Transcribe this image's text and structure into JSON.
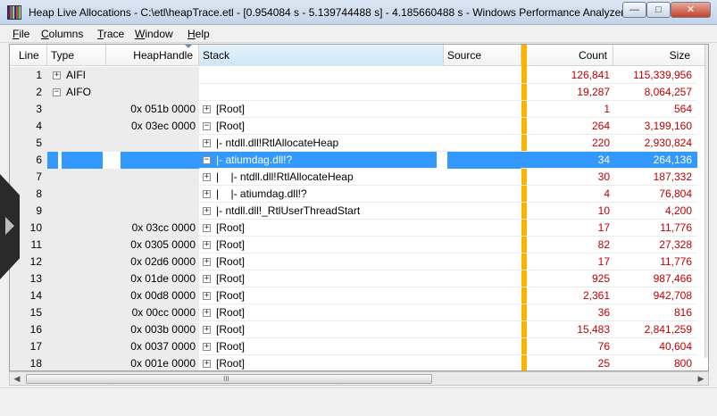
{
  "window": {
    "title": "Heap Live Allocations - C:\\etl\\heapTrace.etl - [0.954084 s - 5.139744488 s] - 4.185660488 s - Windows Performance Analyzer",
    "min_glyph": "—",
    "max_glyph": "□",
    "close_glyph": "✕"
  },
  "menu": [
    {
      "acc": "F",
      "rest": "ile"
    },
    {
      "acc": "C",
      "rest": "olumns"
    },
    {
      "acc": "T",
      "rest": "race"
    },
    {
      "acc": "W",
      "rest": "indow"
    },
    {
      "acc": "H",
      "rest": "elp"
    }
  ],
  "columns": {
    "line": "Line",
    "type": "Type",
    "heaphandle": "HeapHandle",
    "stack": "Stack",
    "source": "Source",
    "count": "Count",
    "size": "Size"
  },
  "rows": [
    {
      "line": "1",
      "type_exp": "+",
      "type": "AIFI",
      "hh": "",
      "stack_exp": "",
      "stack": "",
      "count": "126,841",
      "size": "115,339,956"
    },
    {
      "line": "2",
      "type_exp": "−",
      "type": "AIFO",
      "hh": "",
      "stack_exp": "",
      "stack": "",
      "count": "19,287",
      "size": "8,064,257"
    },
    {
      "line": "3",
      "type_exp": "",
      "type": "",
      "hh": "0x 051b 0000",
      "stack_exp": "+",
      "stack": "[Root]",
      "count": "1",
      "size": "564"
    },
    {
      "line": "4",
      "type_exp": "",
      "type": "",
      "hh": "0x 03ec 0000",
      "stack_exp": "−",
      "stack": "[Root]",
      "count": "264",
      "size": "3,199,160"
    },
    {
      "line": "5",
      "type_exp": "",
      "type": "",
      "hh": "",
      "stack_exp": "+",
      "stack": "|- ntdll.dll!RtlAllocateHeap",
      "count": "220",
      "size": "2,930,824"
    },
    {
      "line": "6",
      "type_exp": "",
      "type": "",
      "hh": "",
      "stack_exp": "−",
      "stack": "|- atiumdag.dll!?",
      "count": "34",
      "size": "264,136"
    },
    {
      "line": "7",
      "type_exp": "",
      "type": "",
      "hh": "",
      "stack_exp": "+",
      "stack": "|    |- ntdll.dll!RtlAllocateHeap",
      "count": "30",
      "size": "187,332"
    },
    {
      "line": "8",
      "type_exp": "",
      "type": "",
      "hh": "",
      "stack_exp": "+",
      "stack": "|    |- atiumdag.dll!?",
      "count": "4",
      "size": "76,804"
    },
    {
      "line": "9",
      "type_exp": "",
      "type": "",
      "hh": "",
      "stack_exp": "+",
      "stack": "|- ntdll.dll!_RtlUserThreadStart",
      "count": "10",
      "size": "4,200"
    },
    {
      "line": "10",
      "type_exp": "",
      "type": "",
      "hh": "0x 03cc 0000",
      "stack_exp": "+",
      "stack": "[Root]",
      "count": "17",
      "size": "11,776"
    },
    {
      "line": "11",
      "type_exp": "",
      "type": "",
      "hh": "0x 0305 0000",
      "stack_exp": "+",
      "stack": "[Root]",
      "count": "82",
      "size": "27,328"
    },
    {
      "line": "12",
      "type_exp": "",
      "type": "",
      "hh": "0x 02d6 0000",
      "stack_exp": "+",
      "stack": "[Root]",
      "count": "17",
      "size": "11,776"
    },
    {
      "line": "13",
      "type_exp": "",
      "type": "",
      "hh": "0x 01de 0000",
      "stack_exp": "+",
      "stack": "[Root]",
      "count": "925",
      "size": "987,466"
    },
    {
      "line": "14",
      "type_exp": "",
      "type": "",
      "hh": "0x 00d8 0000",
      "stack_exp": "+",
      "stack": "[Root]",
      "count": "2,361",
      "size": "942,708"
    },
    {
      "line": "15",
      "type_exp": "",
      "type": "",
      "hh": "0x 00cc 0000",
      "stack_exp": "+",
      "stack": "[Root]",
      "count": "36",
      "size": "816"
    },
    {
      "line": "16",
      "type_exp": "",
      "type": "",
      "hh": "0x 003b 0000",
      "stack_exp": "+",
      "stack": "[Root]",
      "count": "15,483",
      "size": "2,841,259"
    },
    {
      "line": "17",
      "type_exp": "",
      "type": "",
      "hh": "0x 0037 0000",
      "stack_exp": "+",
      "stack": "[Root]",
      "count": "76",
      "size": "40,604"
    },
    {
      "line": "18",
      "type_exp": "",
      "type": "",
      "hh": "0x 001e 0000",
      "stack_exp": "+",
      "stack": "[Root]",
      "count": "25",
      "size": "800"
    }
  ],
  "selected_line": "6",
  "colors": {
    "selection": "#3399ff",
    "numbers": "#c00000",
    "divider": "#f7b500"
  },
  "scroll": {
    "up": "▲",
    "down": "▼",
    "left": "◀",
    "right": "▶",
    "grip": "III"
  }
}
